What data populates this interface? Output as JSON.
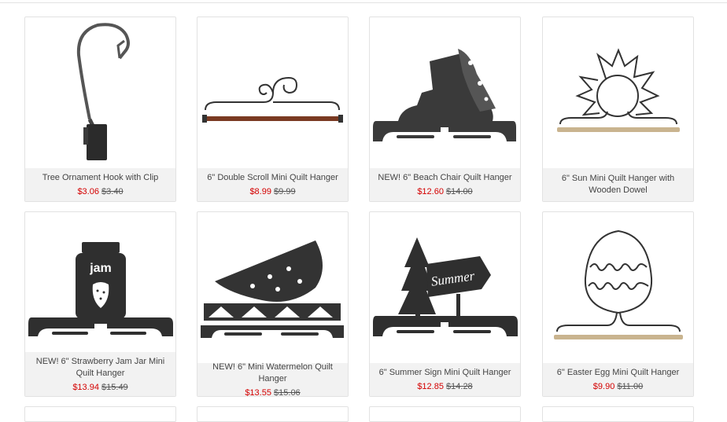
{
  "products": [
    {
      "name": "Tree Ornament Hook with Clip",
      "sale_price": "$3.06",
      "original_price": "$3.40",
      "icon": "tree-ornament-hook-icon"
    },
    {
      "name": "6\" Double Scroll Mini Quilt Hanger",
      "sale_price": "$8.99",
      "original_price": "$9.99",
      "icon": "double-scroll-hanger-icon"
    },
    {
      "name": "NEW! 6\" Beach Chair Quilt Hanger",
      "sale_price": "$12.60",
      "original_price": "$14.00",
      "icon": "beach-chair-hanger-icon"
    },
    {
      "name": "6\" Sun Mini Quilt Hanger with Wooden Dowel",
      "sale_price": "",
      "original_price": "",
      "icon": "sun-hanger-icon"
    },
    {
      "name": "NEW! 6\" Strawberry Jam Jar Mini Quilt Hanger",
      "sale_price": "$13.94",
      "original_price": "$15.49",
      "icon": "jam-jar-hanger-icon",
      "image_text": "jam"
    },
    {
      "name": "NEW! 6\" Mini Watermelon Quilt Hanger",
      "sale_price": "$13.55",
      "original_price": "$15.06",
      "icon": "watermelon-hanger-icon"
    },
    {
      "name": "6\" Summer Sign Mini Quilt Hanger",
      "sale_price": "$12.85",
      "original_price": "$14.28",
      "icon": "summer-sign-hanger-icon",
      "image_text": "Summer"
    },
    {
      "name": "6\" Easter Egg Mini Quilt Hanger",
      "sale_price": "$9.90",
      "original_price": "$11.00",
      "icon": "easter-egg-hanger-icon"
    }
  ],
  "colors": {
    "sale": "#d40000",
    "metal": "#2e2e2e",
    "dowel_dark": "#7a3a22",
    "dowel_light": "#c9b48f"
  }
}
